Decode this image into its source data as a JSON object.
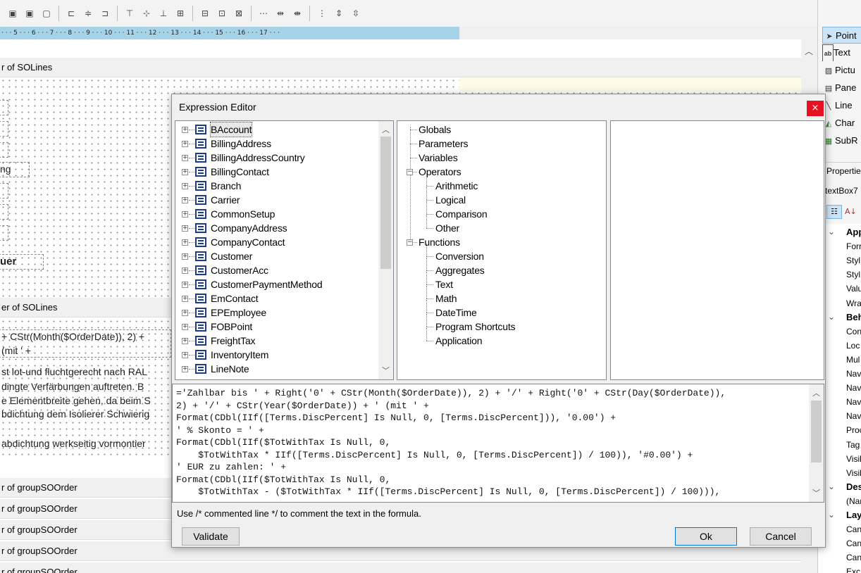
{
  "ruler": {
    "text": "· · · 5 · · · 6 · · · 7 · · · 8 · · · 9 · · · 10 · · · 11 · · · 12 · · · 13 · · · 14 · · · 15 · · · 16 · · · 17 · · ·"
  },
  "designer": {
    "bands": [
      {
        "label": "r of SOLines"
      },
      {
        "label": "er of SOLines"
      },
      {
        "label": "r of groupSOOrder"
      },
      {
        "label": "r of groupSOOrder"
      },
      {
        "label": "r of groupSOOrder"
      },
      {
        "label": "r of groupSOOrder"
      },
      {
        "label": "r of groupSOOrder"
      }
    ],
    "fragments": [
      "ng",
      "uer",
      "+ CStr(Month($OrderDate)), 2) +",
      "(mit ' +",
      "st lot-und fluchtgerecht nach RAL",
      "dingte Verfärbungen auftreten. B",
      "e Elementbreite gehen, da beim S",
      "bdichtung dem Isolierer Schwierig",
      "abdichtung werkseitig vormontier"
    ]
  },
  "toolbox": {
    "tools": [
      {
        "label": "Point",
        "icon": "pointer-icon"
      },
      {
        "label": "Text",
        "icon": "textbox-icon"
      },
      {
        "label": "Pictu",
        "icon": "picture-icon"
      },
      {
        "label": "Pane",
        "icon": "panel-icon"
      },
      {
        "label": "Line",
        "icon": "line-icon"
      },
      {
        "label": "Char",
        "icon": "chart-icon"
      },
      {
        "label": "SubR",
        "icon": "subreport-icon"
      }
    ],
    "properties_title": "Propertie",
    "selected_object": "textBox7",
    "properties": [
      {
        "label": "App",
        "category": true
      },
      {
        "label": "Forr"
      },
      {
        "label": "Styl"
      },
      {
        "label": "Styl"
      },
      {
        "label": "Valu"
      },
      {
        "label": "Wra"
      },
      {
        "label": "Beh",
        "category": true
      },
      {
        "label": "Con"
      },
      {
        "label": "Loc"
      },
      {
        "label": "Mul"
      },
      {
        "label": "Nav"
      },
      {
        "label": "Nav"
      },
      {
        "label": "Nav"
      },
      {
        "label": "Nav"
      },
      {
        "label": "Proc"
      },
      {
        "label": "Tag"
      },
      {
        "label": "Visil"
      },
      {
        "label": "Visil"
      },
      {
        "label": "Des",
        "category": true
      },
      {
        "label": "(Nar"
      },
      {
        "label": "Lay",
        "category": true
      },
      {
        "label": "Can"
      },
      {
        "label": "Can"
      },
      {
        "label": "Can"
      },
      {
        "label": "Exc"
      }
    ]
  },
  "dialog": {
    "title": "Expression Editor",
    "close_glyph": "×",
    "fields": [
      "BAccount",
      "BillingAddress",
      "BillingAddressCountry",
      "BillingContact",
      "Branch",
      "Carrier",
      "CommonSetup",
      "CompanyAddress",
      "CompanyContact",
      "Customer",
      "CustomerAcc",
      "CustomerPaymentMethod",
      "EmContact",
      "EPEmployee",
      "FOBPoint",
      "FreightTax",
      "InventoryItem",
      "LineNote"
    ],
    "categories": [
      {
        "label": "Globals",
        "level": 0
      },
      {
        "label": "Parameters",
        "level": 0
      },
      {
        "label": "Variables",
        "level": 0
      },
      {
        "label": "Operators",
        "level": 0,
        "expandable": true
      },
      {
        "label": "Arithmetic",
        "level": 1
      },
      {
        "label": "Logical",
        "level": 1
      },
      {
        "label": "Comparison",
        "level": 1
      },
      {
        "label": "Other",
        "level": 1
      },
      {
        "label": "Functions",
        "level": 0,
        "expandable": true
      },
      {
        "label": "Conversion",
        "level": 1
      },
      {
        "label": "Aggregates",
        "level": 1
      },
      {
        "label": "Text",
        "level": 1
      },
      {
        "label": "Math",
        "level": 1
      },
      {
        "label": "DateTime",
        "level": 1
      },
      {
        "label": "Program Shortcuts",
        "level": 1
      },
      {
        "label": "Application",
        "level": 1
      }
    ],
    "expression": "='Zahlbar bis ' + Right('0' + CStr(Month($OrderDate)), 2) + '/' + Right('0' + CStr(Day($OrderDate)),\n2) + '/' + CStr(Year($OrderDate)) + ' (mit ' +\nFormat(CDbl(IIf([Terms.DiscPercent] Is Null, 0, [Terms.DiscPercent])), '0.00') +\n' % Skonto = ' +\nFormat(CDbl(IIf($TotWithTax Is Null, 0,\n    $TotWithTax * IIf([Terms.DiscPercent] Is Null, 0, [Terms.DiscPercent]) / 100)), '#0.00') +\n' EUR zu zahlen: ' +\nFormat(CDbl(IIf($TotWithTax Is Null, 0,\n    $TotWithTax - ($TotWithTax * IIf([Terms.DiscPercent] Is Null, 0, [Terms.DiscPercent]) / 100))),",
    "hint": "Use /* commented line */ to comment the text in the formula.",
    "validate_label": "Validate",
    "ok_label": "Ok",
    "cancel_label": "Cancel"
  }
}
